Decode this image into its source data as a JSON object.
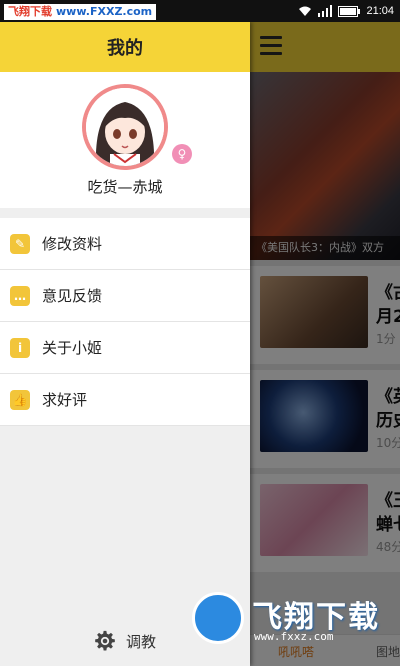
{
  "status_bar": {
    "watermark_left": "飞翔下载",
    "watermark_url": "www.FXXZ.com",
    "time": "21:04"
  },
  "drawer": {
    "title": "我的",
    "profile": {
      "username": "吃货—赤城",
      "gender_icon": "female-icon"
    },
    "menu": [
      {
        "label": "修改资料",
        "icon": "edit-icon"
      },
      {
        "label": "意见反馈",
        "icon": "chat-icon"
      },
      {
        "label": "关于小姬",
        "icon": "info-icon"
      },
      {
        "label": "求好评",
        "icon": "thumbs-up-icon"
      }
    ],
    "footer": {
      "label": "调教",
      "icon": "gear-icon"
    }
  },
  "background": {
    "banner_caption": "《美国队长3：内战》双方",
    "items": [
      {
        "title1": "《古",
        "title2": "月2",
        "meta": "1分"
      },
      {
        "title1": "《英",
        "title2": "历史",
        "meta": "10分"
      },
      {
        "title1": "《王",
        "title2": "蝉七",
        "meta": "48分"
      }
    ],
    "nav_left": "吼吼嗒",
    "nav_right": "图地"
  },
  "watermark_bottom": {
    "brand": "飞翔下载",
    "url": "www.fxxz.com"
  },
  "colors": {
    "accent_yellow": "#f5d437",
    "avatar_ring": "#f08a8a"
  }
}
